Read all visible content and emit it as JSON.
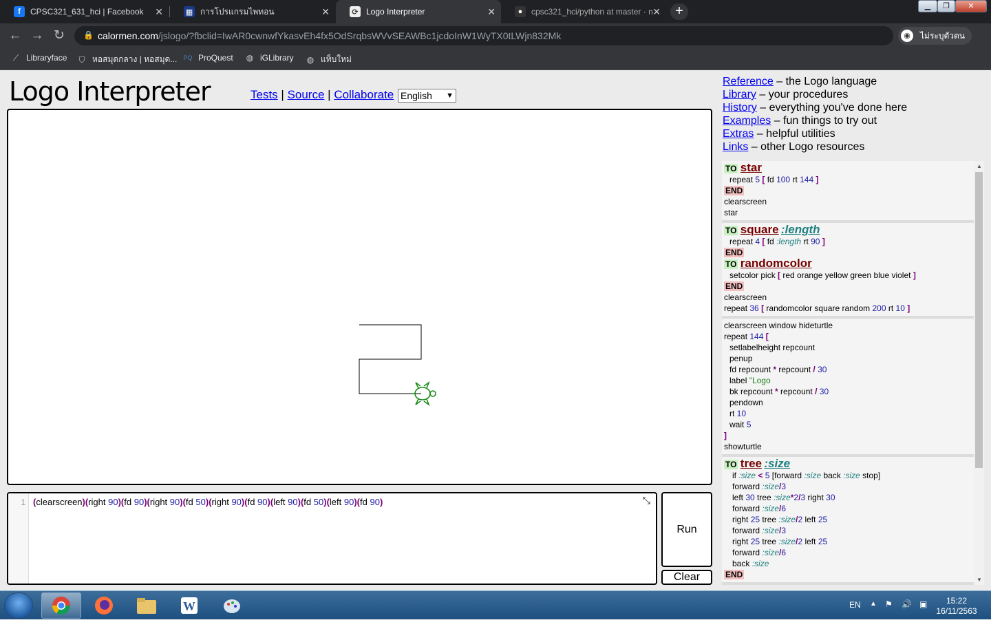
{
  "browser": {
    "tabs": [
      {
        "title": "CPSC321_631_hci | Facebook",
        "icon": "facebook-icon",
        "color": "#1877f2"
      },
      {
        "title": "การโปรแกรมไพทอน",
        "icon": "site-icon",
        "color": "#1a3a8a"
      },
      {
        "title": "Logo Interpreter",
        "icon": "logo-interpreter-icon",
        "color": "#555"
      },
      {
        "title": "cpsc321_hci/python at master · n",
        "icon": "github-icon",
        "color": "#333"
      }
    ],
    "url_host": "calormen.com",
    "url_path": "/jslogo/?fbclid=IwAR0cwnwfYkasvEh4fx5OdSrqbsWVvSEAWBc1jcdoInW1WyTX0tLWjn832Mk",
    "profile_label": "ไม่ระบุตัวตน",
    "bookmarks": [
      "Libraryface",
      "หอสมุดกลาง | หอสมุด...",
      "ProQuest",
      "iGLibrary",
      "แท็บใหม่"
    ]
  },
  "page": {
    "title": "Logo Interpreter",
    "links": [
      "Tests",
      "Source",
      "Collaborate"
    ],
    "language": "English",
    "run_label": "Run",
    "clear_label": "Clear",
    "line_number": "1",
    "side_nav": [
      {
        "link": "Reference",
        "desc": " – the Logo language"
      },
      {
        "link": "Library",
        "desc": " – your procedures"
      },
      {
        "link": "History",
        "desc": " – everything you've done here"
      },
      {
        "link": "Examples",
        "desc": " – fun things to try out"
      },
      {
        "link": "Extras",
        "desc": " – helpful utilities"
      },
      {
        "link": "Links",
        "desc": " – other Logo resources"
      }
    ]
  },
  "taskbar": {
    "lang": "EN",
    "time": "15:22",
    "date": "16/11/2563"
  },
  "colors": {
    "accent_link": "#0000ee",
    "turtle": "#1a8a1a"
  }
}
